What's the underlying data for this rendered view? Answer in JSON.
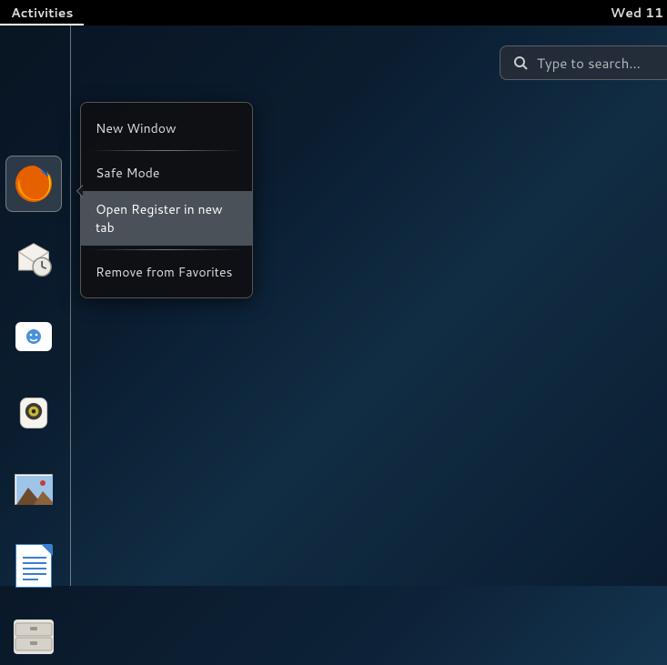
{
  "topbar": {
    "activities": "Activities",
    "clock": "Wed 11"
  },
  "search": {
    "placeholder": "Type to search..."
  },
  "context_menu": {
    "items": [
      {
        "label": "New Window"
      },
      {
        "label": "Safe Mode"
      },
      {
        "label": "Open Register in new tab",
        "highlighted": true
      },
      {
        "label": "Remove from Favorites"
      }
    ]
  },
  "dash": {
    "items": [
      {
        "name": "firefox",
        "selected": true
      },
      {
        "name": "evolution"
      },
      {
        "name": "empathy"
      },
      {
        "name": "rhythmbox"
      },
      {
        "name": "shotwell"
      },
      {
        "name": "libreoffice-writer"
      },
      {
        "name": "files"
      }
    ]
  }
}
